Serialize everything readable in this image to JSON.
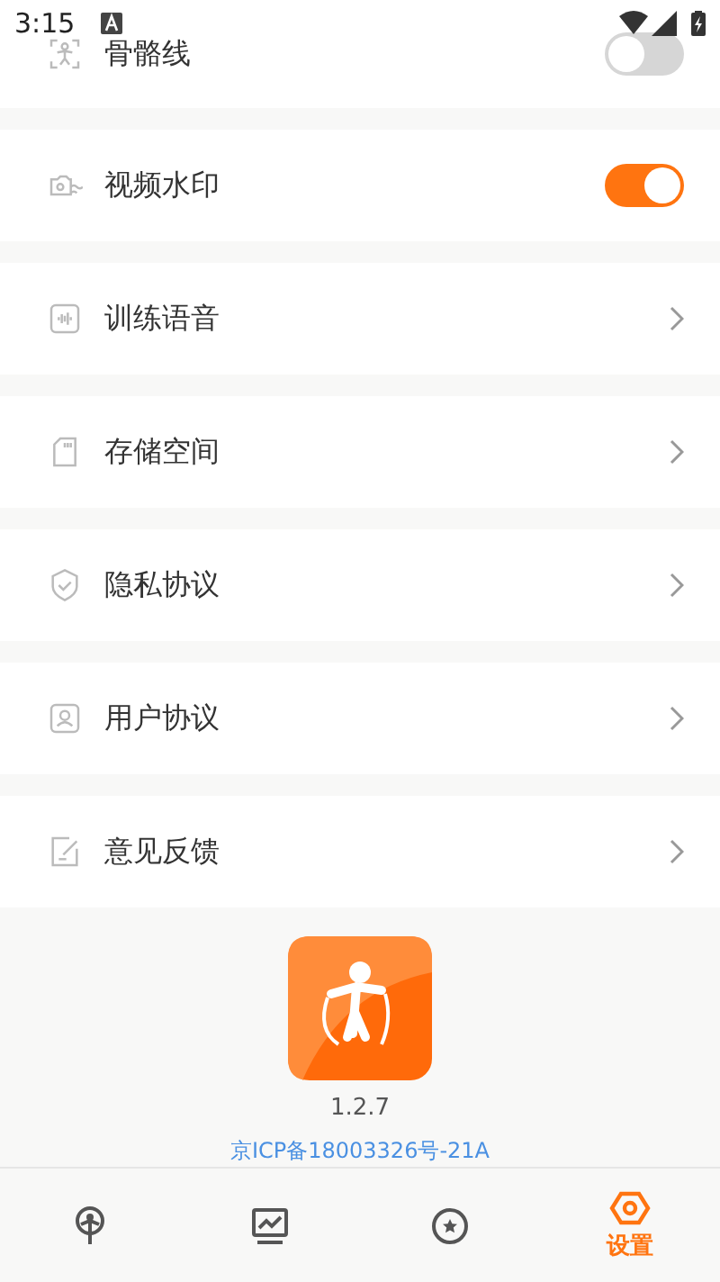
{
  "status_bar": {
    "time": "3:15"
  },
  "settings": [
    {
      "kind": "toggle",
      "label": "骨骼线",
      "on": false
    },
    {
      "kind": "toggle",
      "label": "视频水印",
      "on": true
    },
    {
      "kind": "link",
      "label": "训练语音"
    },
    {
      "kind": "link",
      "label": "存储空间"
    },
    {
      "kind": "link",
      "label": "隐私协议"
    },
    {
      "kind": "link",
      "label": "用户协议"
    },
    {
      "kind": "link",
      "label": "意见反馈"
    }
  ],
  "about": {
    "version": "1.2.7",
    "icp": "京ICP备18003326号-21A"
  },
  "tabs": [
    {
      "selected": false
    },
    {
      "selected": false
    },
    {
      "selected": false
    },
    {
      "label": "设置",
      "selected": true
    }
  ]
}
